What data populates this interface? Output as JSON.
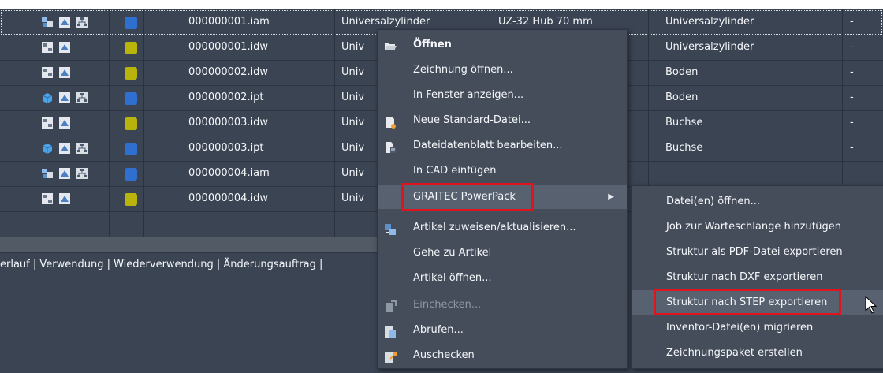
{
  "grid": {
    "rows": [
      {
        "file": "000000001.iam",
        "col2": "Universalzylinder",
        "col3": "UZ-32 Hub 70 mm",
        "title": "Universalzylinder",
        "end": "-",
        "icons": [
          "assembly",
          "drawing",
          "tree"
        ],
        "status": "blue"
      },
      {
        "file": "000000001.idw",
        "col2": "Univ",
        "col3": "",
        "title": "Universalzylinder",
        "end": "-",
        "icons": [
          "sheet",
          "drawing"
        ],
        "status": "yellow"
      },
      {
        "file": "000000002.idw",
        "col2": "Univ",
        "col3": "",
        "title": "Boden",
        "end": "-",
        "icons": [
          "sheet",
          "drawing"
        ],
        "status": "yellow"
      },
      {
        "file": "000000002.ipt",
        "col2": "Univ",
        "col3": "",
        "title": "Boden",
        "end": "-",
        "icons": [
          "part",
          "drawing",
          "tree"
        ],
        "status": "blue"
      },
      {
        "file": "000000003.idw",
        "col2": "Univ",
        "col3": "",
        "title": "Buchse",
        "end": "-",
        "icons": [
          "sheet",
          "drawing"
        ],
        "status": "yellow"
      },
      {
        "file": "000000003.ipt",
        "col2": "Univ",
        "col3": "",
        "title": "Buchse",
        "end": "-",
        "icons": [
          "part",
          "drawing",
          "tree"
        ],
        "status": "blue"
      },
      {
        "file": "000000004.iam",
        "col2": "Univ",
        "col3": "",
        "title": "",
        "end": "",
        "icons": [
          "assembly",
          "drawing",
          "tree"
        ],
        "status": "blue"
      },
      {
        "file": "000000004.idw",
        "col2": "Univ",
        "col3": "",
        "title": "",
        "end": "",
        "icons": [
          "sheet",
          "drawing"
        ],
        "status": "yellow"
      }
    ]
  },
  "tabs_line": "erlauf | Verwendung | Wiederverwendung | Änderungsauftrag |",
  "context_menu": {
    "items": [
      {
        "label": "Öffnen",
        "icon": "folder-open-icon",
        "bold": true
      },
      {
        "label": "Zeichnung öffnen...",
        "icon": ""
      },
      {
        "label": "In Fenster anzeigen...",
        "icon": ""
      },
      {
        "label": "Neue Standard-Datei...",
        "icon": "new-file-icon"
      },
      {
        "label": "Dateidatenblatt bearbeiten...",
        "icon": "datasheet-icon"
      },
      {
        "label": "In CAD einfügen",
        "icon": ""
      },
      {
        "label": "GRAITEC PowerPack",
        "icon": "",
        "submenu": true
      },
      {
        "label": "Artikel zuweisen/aktualisieren...",
        "icon": "assign-item-icon"
      },
      {
        "label": "Gehe zu Artikel",
        "icon": ""
      },
      {
        "label": "Artikel öffnen...",
        "icon": ""
      },
      {
        "label": "Einchecken...",
        "icon": "checkin-icon",
        "disabled": true
      },
      {
        "label": "Abrufen...",
        "icon": "get-icon"
      },
      {
        "label": "Auschecken",
        "icon": "checkout-icon"
      }
    ]
  },
  "submenu": {
    "items": [
      {
        "label": "Datei(en) öffnen..."
      },
      {
        "label": "Job zur Warteschlange hinzufügen"
      },
      {
        "label": "Struktur als PDF-Datei exportieren"
      },
      {
        "label": "Struktur nach DXF exportieren"
      },
      {
        "label": "Struktur nach STEP exportieren"
      },
      {
        "label": "Inventor-Datei(en) migrieren"
      },
      {
        "label": "Zeichnungspaket erstellen"
      }
    ]
  },
  "colors": {
    "highlight_box": "#e0141e",
    "status_blue": "#2f6fd0",
    "status_yellow": "#b8b40c"
  }
}
